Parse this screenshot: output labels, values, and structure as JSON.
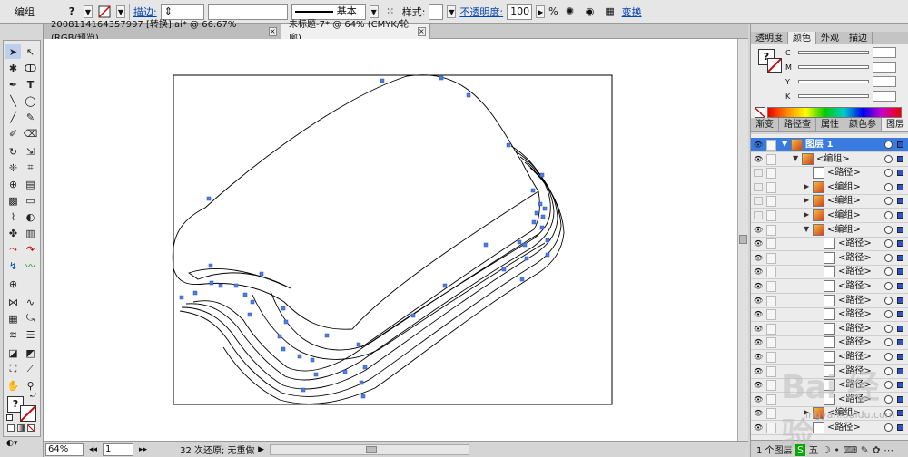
{
  "control_bar": {
    "selection_label": "编组",
    "stroke_label": "描边:",
    "stroke_preset": "基本",
    "style_label": "样式:",
    "opacity_label": "不透明度:",
    "opacity_value": "100",
    "opacity_unit": "%",
    "transform_link": "变换"
  },
  "tabs": [
    {
      "label": "2008114164357997 [转换].ai* @ 66.67% (RGB/预览)",
      "active": false
    },
    {
      "label": "未标题-7* @ 64% (CMYK/轮廓)",
      "active": true
    }
  ],
  "status_bar": {
    "zoom": "64%",
    "page": "1",
    "undo_text": "32 次还原; 无重做"
  },
  "color_panel": {
    "tabs": [
      "透明度",
      "颜色",
      "外观",
      "描边"
    ],
    "active_tab": "颜色",
    "channels": [
      "C",
      "M",
      "Y",
      "K"
    ],
    "unit": "%"
  },
  "layers_panel": {
    "tabs": [
      "渐变",
      "路径查",
      "属性",
      "颜色参",
      "图层"
    ],
    "active_tab": "图层",
    "rows": [
      {
        "name": "图层 1",
        "indent": 0,
        "type": "layer",
        "expanded": true,
        "visible": true
      },
      {
        "name": "<编组>",
        "indent": 1,
        "type": "group",
        "expanded": true,
        "visible": true
      },
      {
        "name": "<路径>",
        "indent": 2,
        "type": "path",
        "visible": false
      },
      {
        "name": "<编组>",
        "indent": 2,
        "type": "group",
        "expanded": false,
        "visible": false
      },
      {
        "name": "<编组>",
        "indent": 2,
        "type": "group",
        "expanded": false,
        "visible": false
      },
      {
        "name": "<编组>",
        "indent": 2,
        "type": "group",
        "expanded": false,
        "visible": false
      },
      {
        "name": "<编组>",
        "indent": 2,
        "type": "group",
        "expanded": true,
        "visible": true
      },
      {
        "name": "<路径>",
        "indent": 3,
        "type": "path",
        "visible": true
      },
      {
        "name": "<路径>",
        "indent": 3,
        "type": "path",
        "visible": true
      },
      {
        "name": "<路径>",
        "indent": 3,
        "type": "path",
        "visible": true
      },
      {
        "name": "<路径>",
        "indent": 3,
        "type": "path",
        "visible": true
      },
      {
        "name": "<路径>",
        "indent": 3,
        "type": "path",
        "visible": true
      },
      {
        "name": "<路径>",
        "indent": 3,
        "type": "path",
        "visible": true
      },
      {
        "name": "<路径>",
        "indent": 3,
        "type": "path",
        "visible": true
      },
      {
        "name": "<路径>",
        "indent": 3,
        "type": "path",
        "visible": true
      },
      {
        "name": "<路径>",
        "indent": 3,
        "type": "path",
        "visible": true
      },
      {
        "name": "<路径>",
        "indent": 3,
        "type": "path",
        "visible": true
      },
      {
        "name": "<路径>",
        "indent": 3,
        "type": "path",
        "visible": true
      },
      {
        "name": "<路径>",
        "indent": 3,
        "type": "path",
        "visible": true
      },
      {
        "name": "<编组>",
        "indent": 2,
        "type": "group",
        "expanded": false,
        "visible": true
      },
      {
        "name": "<路径>",
        "indent": 2,
        "type": "path",
        "visible": true
      }
    ],
    "footer": "1 个图层"
  },
  "watermark": {
    "text": "Bai 经验",
    "url": "jingyan.baidu.com"
  },
  "taskbar_text": "五"
}
